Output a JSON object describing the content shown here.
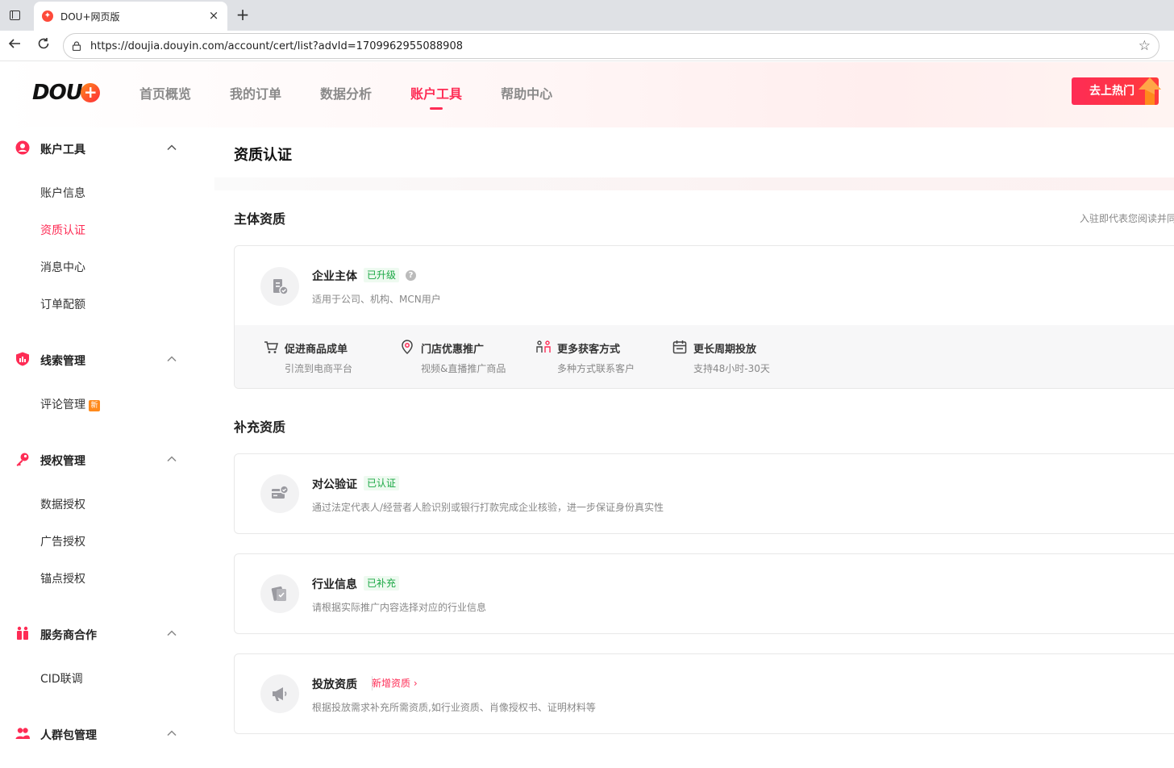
{
  "browser": {
    "tab_title": "DOU+网页版",
    "tab_close": "×",
    "new_tab": "+",
    "url": "https://doujia.douyin.com/account/cert/list?advId=1709962955088908"
  },
  "header": {
    "logo_text": "DOU",
    "logo_plus": "+",
    "nav": [
      {
        "label": "首页概览",
        "active": false
      },
      {
        "label": "我的订单",
        "active": false
      },
      {
        "label": "数据分析",
        "active": false
      },
      {
        "label": "账户工具",
        "active": true
      },
      {
        "label": "帮助中心",
        "active": false
      }
    ],
    "hot_button": "去上热门"
  },
  "sidebar": {
    "groups": [
      {
        "label": "账户工具",
        "icon": "user-circle-icon",
        "items": [
          "账户信息",
          "资质认证",
          "消息中心",
          "订单配额"
        ]
      },
      {
        "label": "线索管理",
        "icon": "chart-shield-icon",
        "items": [
          "评论管理"
        ],
        "new_badge": "新"
      },
      {
        "label": "授权管理",
        "icon": "key-icon",
        "items": [
          "数据授权",
          "广告授权",
          "锚点授权"
        ]
      },
      {
        "label": "服务商合作",
        "icon": "gift-icon",
        "items": [
          "CID联调"
        ]
      },
      {
        "label": "人群包管理",
        "icon": "users-icon",
        "items": []
      }
    ],
    "active_item": "资质认证"
  },
  "main": {
    "page_title": "资质认证",
    "section1": {
      "title": "主体资质",
      "right_note": "入驻即代表您阅读并同",
      "card": {
        "name": "企业主体",
        "tag": "已升级",
        "help": "?",
        "desc": "适用于公司、机构、MCN用户",
        "features": [
          {
            "title": "促进商品成单",
            "desc": "引流到电商平台",
            "icon": "cart-icon"
          },
          {
            "title": "门店优惠推广",
            "desc": "视频&直播推广商品",
            "icon": "location-pin-icon"
          },
          {
            "title": "更多获客方式",
            "desc": "多种方式联系客户",
            "icon": "people-connect-icon"
          },
          {
            "title": "更长周期投放",
            "desc": "支持48小时-30天",
            "icon": "calendar-icon"
          }
        ]
      }
    },
    "section2": {
      "title": "补充资质",
      "cards": [
        {
          "name": "对公验证",
          "tag": "已认证",
          "desc": "通过法定代表人/经营者人脸识别或银行打款完成企业核验，进一步保证身份真实性"
        },
        {
          "name": "行业信息",
          "tag": "已补充",
          "desc": "请根据实际推广内容选择对应的行业信息"
        },
        {
          "name": "投放资质",
          "link": "新增资质",
          "desc": "根据投放需求补充所需资质,如行业资质、肖像授权书、证明材料等"
        }
      ]
    }
  },
  "colors": {
    "accent": "#fe2c55",
    "success": "#1ba844"
  }
}
